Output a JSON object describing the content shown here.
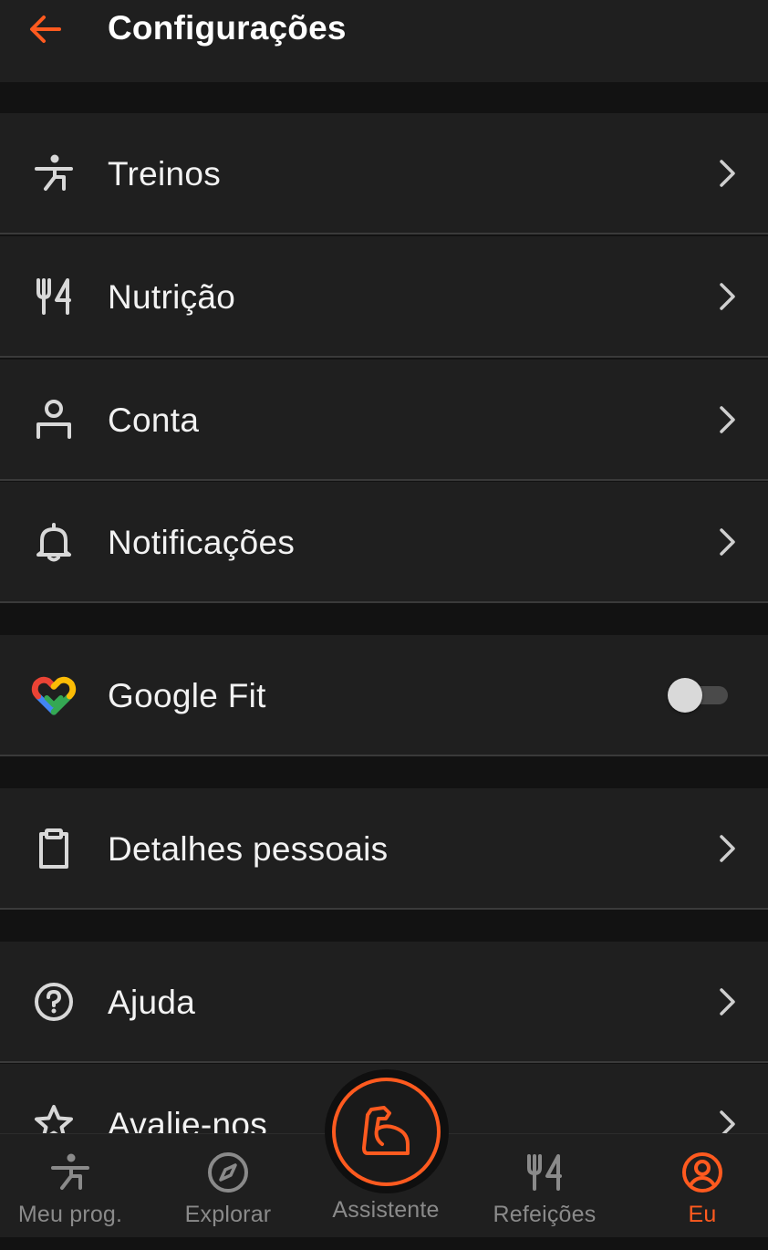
{
  "header": {
    "title": "Configurações"
  },
  "sections": [
    {
      "items": [
        {
          "label": "Treinos",
          "icon": "exercise-icon"
        },
        {
          "label": "Nutrição",
          "icon": "fork-knife-icon"
        },
        {
          "label": "Conta",
          "icon": "person-icon"
        },
        {
          "label": "Notificações",
          "icon": "bell-icon"
        }
      ]
    },
    {
      "items": [
        {
          "label": "Google Fit",
          "icon": "google-fit-icon",
          "toggle": false
        }
      ]
    },
    {
      "items": [
        {
          "label": "Detalhes pessoais",
          "icon": "clipboard-icon"
        }
      ]
    },
    {
      "items": [
        {
          "label": "Ajuda",
          "icon": "help-circle-icon"
        },
        {
          "label": "Avalie-nos",
          "icon": "star-icon"
        }
      ]
    }
  ],
  "bottom_nav": {
    "items": [
      {
        "label": "Meu prog.",
        "icon": "exercise-icon",
        "active": false
      },
      {
        "label": "Explorar",
        "icon": "compass-icon",
        "active": false
      },
      {
        "label": "Assistente",
        "icon": "muscle-arm-icon",
        "active": false
      },
      {
        "label": "Refeições",
        "icon": "fork-knife-icon",
        "active": false
      },
      {
        "label": "Eu",
        "icon": "profile-circle-icon",
        "active": true
      }
    ]
  },
  "colors": {
    "accent": "#ff5a1f",
    "background": "#121212",
    "surface": "#1f1f1f",
    "divider": "#3a3a3a",
    "text_primary": "#f2f2f2",
    "text_muted": "#8a8a8a"
  }
}
